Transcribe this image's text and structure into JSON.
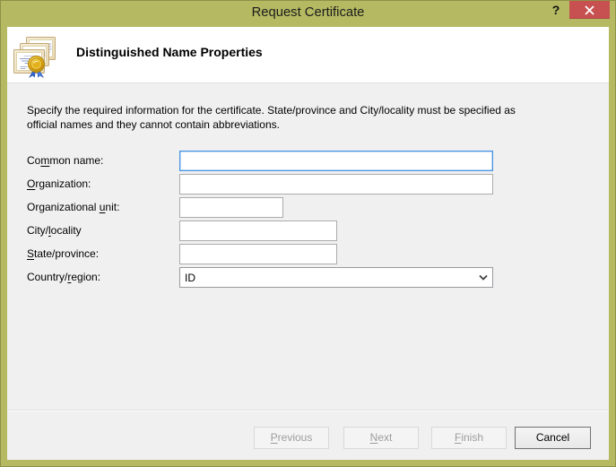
{
  "window": {
    "title": "Request Certificate",
    "help_label": "?",
    "colors": {
      "frame": "#b4b962",
      "close_button": "#c75050",
      "client_bg": "#f0f0f0",
      "focus_border": "#4694e3"
    }
  },
  "header": {
    "title": "Distinguished Name Properties",
    "icon": "certificates-icon"
  },
  "description": {
    "line1": "Specify the required information for the certificate. State/province and City/locality must be specified as",
    "line2": "official names and they cannot contain abbreviations."
  },
  "form": {
    "fields": [
      {
        "id": "common-name",
        "label": {
          "pre": "Co",
          "key": "m",
          "post": "mon name:"
        },
        "value": "",
        "type": "text",
        "state": "focused"
      },
      {
        "id": "organization",
        "label": {
          "pre": "",
          "key": "O",
          "post": "rganization:"
        },
        "value": "",
        "type": "text",
        "state": "normal"
      },
      {
        "id": "organizational-unit",
        "label": {
          "pre": "Organizational ",
          "key": "u",
          "post": "nit:"
        },
        "value": "",
        "type": "text",
        "state": "normal"
      },
      {
        "id": "city-locality",
        "label": {
          "pre": "City/",
          "key": "l",
          "post": "ocality"
        },
        "value": "",
        "type": "text",
        "state": "normal"
      },
      {
        "id": "state-province",
        "label": {
          "pre": "",
          "key": "S",
          "post": "tate/province:"
        },
        "value": "",
        "type": "text",
        "state": "normal"
      },
      {
        "id": "country-region",
        "label": {
          "pre": "Country/",
          "key": "r",
          "post": "egion:"
        },
        "value": "ID",
        "type": "select",
        "state": "normal"
      }
    ]
  },
  "footer": {
    "buttons": [
      {
        "id": "previous",
        "label": {
          "pre": "",
          "key": "P",
          "post": "revious"
        },
        "enabled": false
      },
      {
        "id": "next",
        "label": {
          "pre": "",
          "key": "N",
          "post": "ext"
        },
        "enabled": false
      },
      {
        "id": "finish",
        "label": {
          "pre": "",
          "key": "F",
          "post": "inish"
        },
        "enabled": false
      },
      {
        "id": "cancel",
        "label": {
          "pre": "Cancel",
          "key": "",
          "post": ""
        },
        "enabled": true
      }
    ]
  }
}
